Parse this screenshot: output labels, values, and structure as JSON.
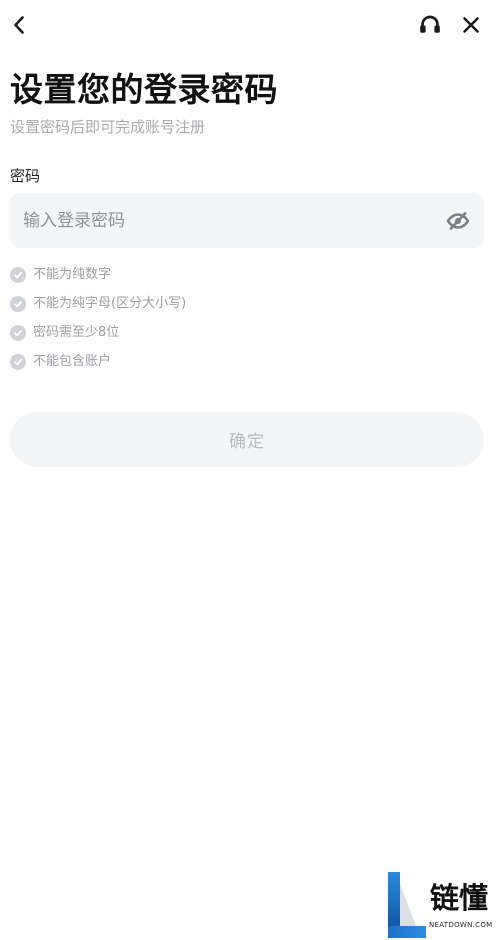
{
  "header": {
    "back_icon": "chevron-left-icon",
    "support_icon": "headset-icon",
    "close_icon": "close-icon"
  },
  "page": {
    "title": "设置您的登录密码",
    "subtitle": "设置密码后即可完成账号注册"
  },
  "password": {
    "label": "密码",
    "placeholder": "输入登录密码",
    "value": "",
    "toggle_icon": "eye-off-icon"
  },
  "rules": [
    {
      "text": "不能为纯数字",
      "status": "pending"
    },
    {
      "text": "不能为纯字母(区分大小写)",
      "status": "pending"
    },
    {
      "text": "密码需至少8位",
      "status": "pending"
    },
    {
      "text": "不能包含账户",
      "status": "pending"
    }
  ],
  "actions": {
    "confirm_label": "确定"
  },
  "watermark": {
    "text": "链懂",
    "url": "NEATDOWN.COM"
  },
  "colors": {
    "input_background": "#f4f5f7",
    "rule_check": "#cfd3d8",
    "placeholder": "#8e9297",
    "disabled_button_text": "#b7babf"
  }
}
